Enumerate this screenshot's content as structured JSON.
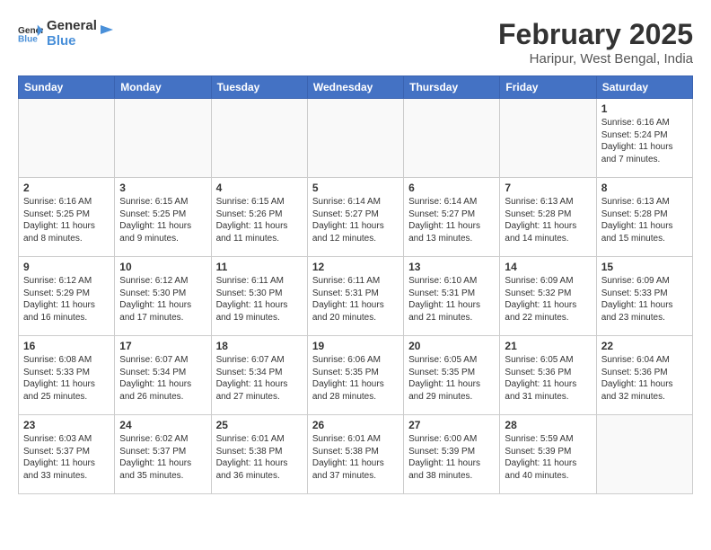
{
  "header": {
    "logo_line1": "General",
    "logo_line2": "Blue",
    "month_year": "February 2025",
    "location": "Haripur, West Bengal, India"
  },
  "weekdays": [
    "Sunday",
    "Monday",
    "Tuesday",
    "Wednesday",
    "Thursday",
    "Friday",
    "Saturday"
  ],
  "weeks": [
    [
      {
        "day": "",
        "info": ""
      },
      {
        "day": "",
        "info": ""
      },
      {
        "day": "",
        "info": ""
      },
      {
        "day": "",
        "info": ""
      },
      {
        "day": "",
        "info": ""
      },
      {
        "day": "",
        "info": ""
      },
      {
        "day": "1",
        "info": "Sunrise: 6:16 AM\nSunset: 5:24 PM\nDaylight: 11 hours and 7 minutes."
      }
    ],
    [
      {
        "day": "2",
        "info": "Sunrise: 6:16 AM\nSunset: 5:25 PM\nDaylight: 11 hours and 8 minutes."
      },
      {
        "day": "3",
        "info": "Sunrise: 6:15 AM\nSunset: 5:25 PM\nDaylight: 11 hours and 9 minutes."
      },
      {
        "day": "4",
        "info": "Sunrise: 6:15 AM\nSunset: 5:26 PM\nDaylight: 11 hours and 11 minutes."
      },
      {
        "day": "5",
        "info": "Sunrise: 6:14 AM\nSunset: 5:27 PM\nDaylight: 11 hours and 12 minutes."
      },
      {
        "day": "6",
        "info": "Sunrise: 6:14 AM\nSunset: 5:27 PM\nDaylight: 11 hours and 13 minutes."
      },
      {
        "day": "7",
        "info": "Sunrise: 6:13 AM\nSunset: 5:28 PM\nDaylight: 11 hours and 14 minutes."
      },
      {
        "day": "8",
        "info": "Sunrise: 6:13 AM\nSunset: 5:28 PM\nDaylight: 11 hours and 15 minutes."
      }
    ],
    [
      {
        "day": "9",
        "info": "Sunrise: 6:12 AM\nSunset: 5:29 PM\nDaylight: 11 hours and 16 minutes."
      },
      {
        "day": "10",
        "info": "Sunrise: 6:12 AM\nSunset: 5:30 PM\nDaylight: 11 hours and 17 minutes."
      },
      {
        "day": "11",
        "info": "Sunrise: 6:11 AM\nSunset: 5:30 PM\nDaylight: 11 hours and 19 minutes."
      },
      {
        "day": "12",
        "info": "Sunrise: 6:11 AM\nSunset: 5:31 PM\nDaylight: 11 hours and 20 minutes."
      },
      {
        "day": "13",
        "info": "Sunrise: 6:10 AM\nSunset: 5:31 PM\nDaylight: 11 hours and 21 minutes."
      },
      {
        "day": "14",
        "info": "Sunrise: 6:09 AM\nSunset: 5:32 PM\nDaylight: 11 hours and 22 minutes."
      },
      {
        "day": "15",
        "info": "Sunrise: 6:09 AM\nSunset: 5:33 PM\nDaylight: 11 hours and 23 minutes."
      }
    ],
    [
      {
        "day": "16",
        "info": "Sunrise: 6:08 AM\nSunset: 5:33 PM\nDaylight: 11 hours and 25 minutes."
      },
      {
        "day": "17",
        "info": "Sunrise: 6:07 AM\nSunset: 5:34 PM\nDaylight: 11 hours and 26 minutes."
      },
      {
        "day": "18",
        "info": "Sunrise: 6:07 AM\nSunset: 5:34 PM\nDaylight: 11 hours and 27 minutes."
      },
      {
        "day": "19",
        "info": "Sunrise: 6:06 AM\nSunset: 5:35 PM\nDaylight: 11 hours and 28 minutes."
      },
      {
        "day": "20",
        "info": "Sunrise: 6:05 AM\nSunset: 5:35 PM\nDaylight: 11 hours and 29 minutes."
      },
      {
        "day": "21",
        "info": "Sunrise: 6:05 AM\nSunset: 5:36 PM\nDaylight: 11 hours and 31 minutes."
      },
      {
        "day": "22",
        "info": "Sunrise: 6:04 AM\nSunset: 5:36 PM\nDaylight: 11 hours and 32 minutes."
      }
    ],
    [
      {
        "day": "23",
        "info": "Sunrise: 6:03 AM\nSunset: 5:37 PM\nDaylight: 11 hours and 33 minutes."
      },
      {
        "day": "24",
        "info": "Sunrise: 6:02 AM\nSunset: 5:37 PM\nDaylight: 11 hours and 35 minutes."
      },
      {
        "day": "25",
        "info": "Sunrise: 6:01 AM\nSunset: 5:38 PM\nDaylight: 11 hours and 36 minutes."
      },
      {
        "day": "26",
        "info": "Sunrise: 6:01 AM\nSunset: 5:38 PM\nDaylight: 11 hours and 37 minutes."
      },
      {
        "day": "27",
        "info": "Sunrise: 6:00 AM\nSunset: 5:39 PM\nDaylight: 11 hours and 38 minutes."
      },
      {
        "day": "28",
        "info": "Sunrise: 5:59 AM\nSunset: 5:39 PM\nDaylight: 11 hours and 40 minutes."
      },
      {
        "day": "",
        "info": ""
      }
    ]
  ]
}
